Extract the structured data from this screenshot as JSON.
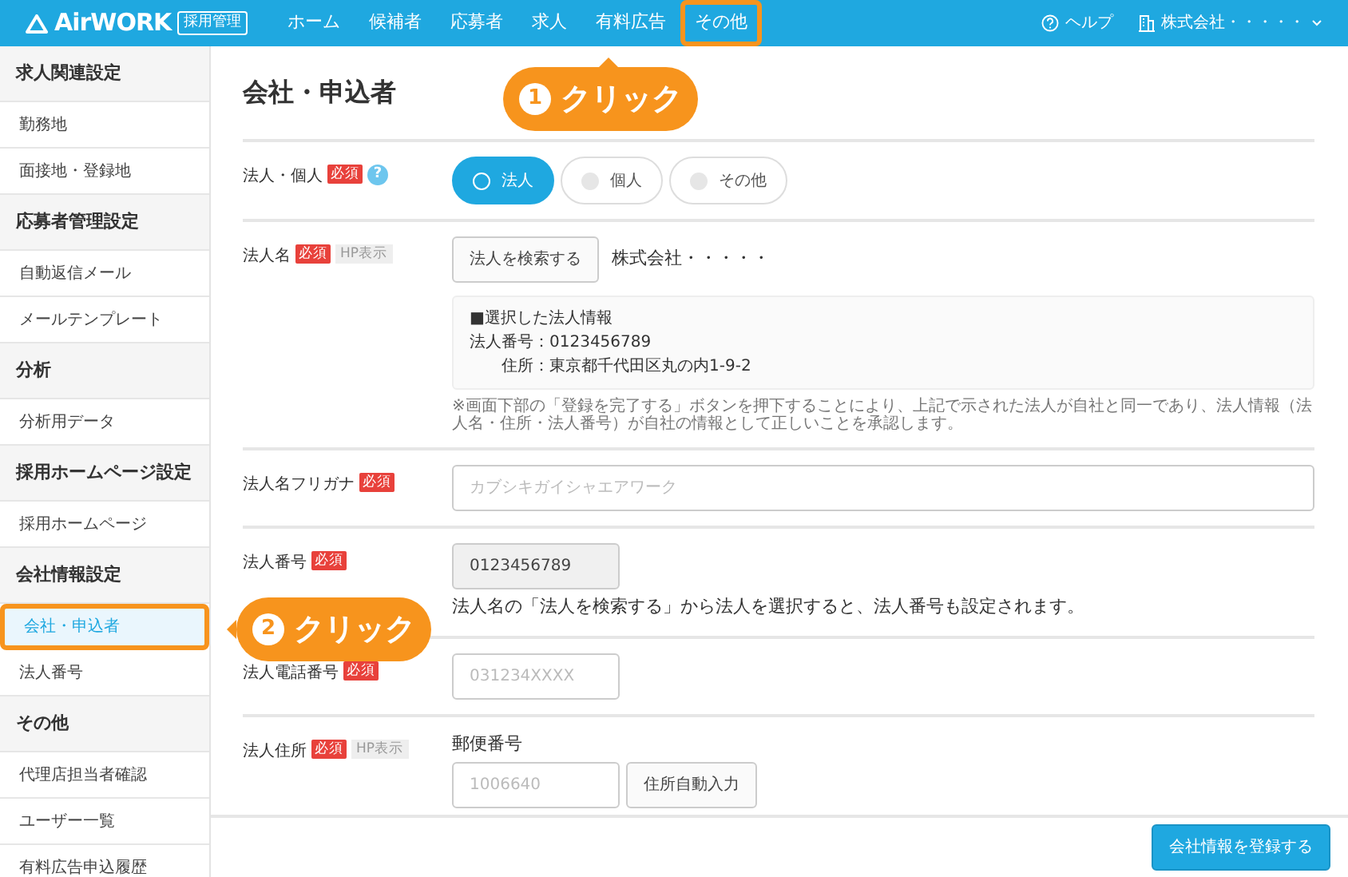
{
  "navbar": {
    "logo": "AirWORK",
    "logo_badge": "採用管理",
    "items": [
      {
        "label": "ホーム",
        "highlighted": false
      },
      {
        "label": "候補者",
        "highlighted": false
      },
      {
        "label": "応募者",
        "highlighted": false
      },
      {
        "label": "求人",
        "highlighted": false
      },
      {
        "label": "有料広告",
        "highlighted": false
      },
      {
        "label": "その他",
        "highlighted": true
      }
    ],
    "help": "ヘルプ",
    "account": "株式会社・・・・・"
  },
  "sidebar": {
    "sections": [
      {
        "title": "求人関連設定",
        "items": [
          {
            "label": "勤務地",
            "selected": false,
            "highlighted": false
          },
          {
            "label": "面接地・登録地",
            "selected": false,
            "highlighted": false
          }
        ]
      },
      {
        "title": "応募者管理設定",
        "items": [
          {
            "label": "自動返信メール",
            "selected": false,
            "highlighted": false
          },
          {
            "label": "メールテンプレート",
            "selected": false,
            "highlighted": false
          }
        ]
      },
      {
        "title": "分析",
        "items": [
          {
            "label": "分析用データ",
            "selected": false,
            "highlighted": false
          }
        ]
      },
      {
        "title": "採用ホームページ設定",
        "items": [
          {
            "label": "採用ホームページ",
            "selected": false,
            "highlighted": false
          }
        ]
      },
      {
        "title": "会社情報設定",
        "items": [
          {
            "label": "会社・申込者",
            "selected": true,
            "highlighted": true
          },
          {
            "label": "法人番号",
            "selected": false,
            "highlighted": false
          }
        ]
      },
      {
        "title": "その他",
        "items": [
          {
            "label": "代理店担当者確認",
            "selected": false,
            "highlighted": false
          },
          {
            "label": "ユーザー一覧",
            "selected": false,
            "highlighted": false
          },
          {
            "label": "有料広告申込履歴",
            "selected": false,
            "highlighted": false
          }
        ]
      }
    ]
  },
  "page_title": "会社・申込者",
  "form_rows": [
    {
      "kind": "radio",
      "label": "法人・個人",
      "required": "必須",
      "help": "?",
      "options": [
        {
          "label": "法人",
          "selected": true
        },
        {
          "label": "個人",
          "selected": false
        },
        {
          "label": "その他",
          "selected": false
        }
      ]
    },
    {
      "kind": "search",
      "label": "法人名",
      "required": "必須",
      "hp_tag": "HP表示",
      "button": "法人を検索する",
      "value": "株式会社・・・・・",
      "info_title": "■選択した法人情報",
      "info_lines": [
        "法人番号：0123456789",
        "住所：東京都千代田区丸の内1-9-2"
      ],
      "note": "※画面下部の「登録を完了する」ボタンを押下することにより、上記で示された法人が自社と同一であり、法人情報（法人名・住所・法人番号）が自社の情報として正しいことを承認します。"
    },
    {
      "kind": "text_wide",
      "label": "法人名フリガナ",
      "required": "必須",
      "placeholder": "カブシキガイシャエアワーク"
    },
    {
      "kind": "readonly",
      "label": "法人番号",
      "required": "必須",
      "value": "0123456789",
      "note": "法人名の「法人を検索する」から法人を選択すると、法人番号も設定されます。"
    },
    {
      "kind": "text_short",
      "label": "法人電話番号",
      "required": "必須",
      "placeholder": "031234XXXX"
    },
    {
      "kind": "address",
      "label": "法人住所",
      "required": "必須",
      "hp_tag": "HP表示",
      "sublabel": "郵便番号",
      "placeholder": "1006640",
      "button": "住所自動入力"
    }
  ],
  "footer": {
    "button": "会社情報を登録する"
  },
  "callouts": [
    {
      "number": "1",
      "text": "クリック"
    },
    {
      "number": "2",
      "text": "クリック"
    }
  ]
}
